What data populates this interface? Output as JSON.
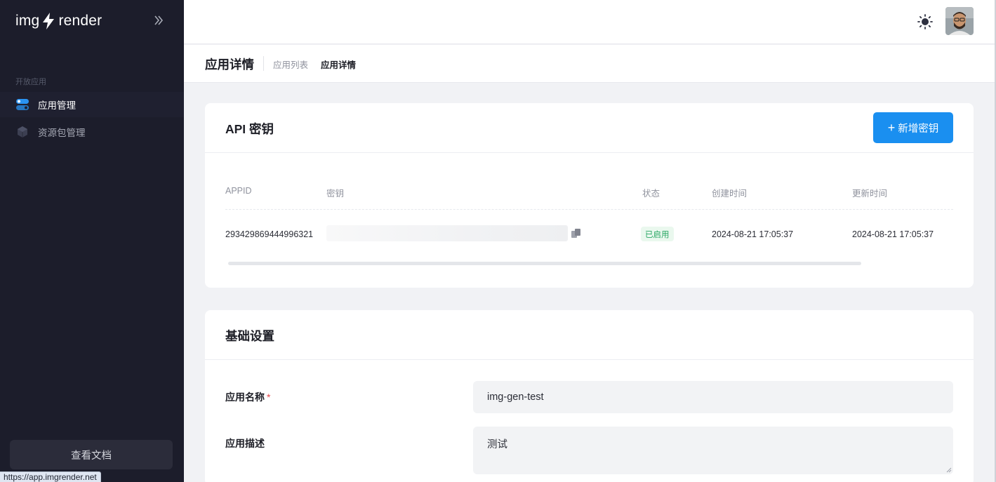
{
  "brand": {
    "left": "img",
    "right": "render"
  },
  "sidebar": {
    "section": "开放应用",
    "items": [
      {
        "label": "应用管理",
        "icon": "toggle-icon",
        "active": true
      },
      {
        "label": "资源包管理",
        "icon": "box-icon",
        "active": false
      }
    ],
    "docs_button": "查看文档"
  },
  "status_url": "https://app.imgrender.net",
  "header": {
    "title": "应用详情",
    "breadcrumb": [
      "应用列表",
      "应用详情"
    ]
  },
  "api_card": {
    "title": "API 密钥",
    "add_button": "新增密钥",
    "columns": [
      "APPID",
      "密钥",
      "状态",
      "创建时间",
      "更新时间"
    ],
    "rows": [
      {
        "appid": "293429869444996321",
        "status": "已启用",
        "created": "2024-08-21 17:05:37",
        "updated": "2024-08-21 17:05:37"
      }
    ]
  },
  "base_card": {
    "title": "基础设置",
    "name_label": "应用名称",
    "required_mark": "*",
    "name_value": "img-gen-test",
    "desc_label": "应用描述",
    "desc_value": "测试"
  },
  "colors": {
    "primary": "#1a8ff0",
    "sidebar_bg": "#1c1d2b",
    "success": "#2aa764"
  }
}
